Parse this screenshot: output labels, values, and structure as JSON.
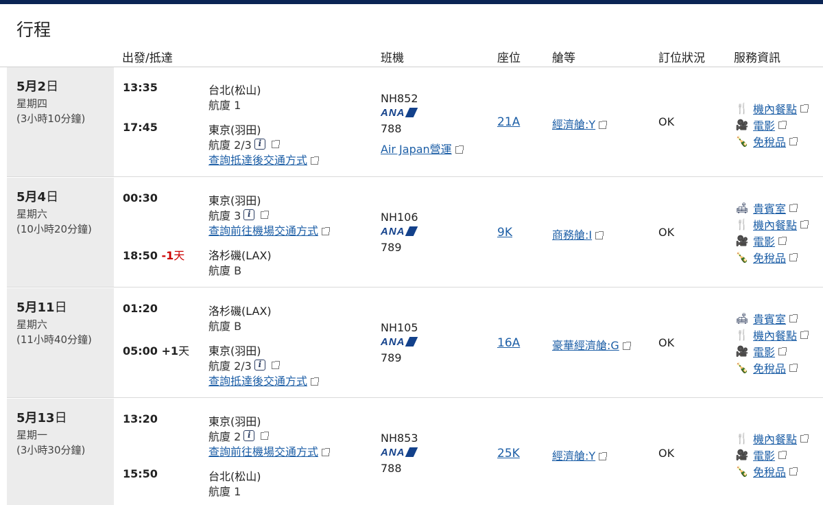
{
  "title": "行程",
  "headers": {
    "dep_arr": "出發/抵達",
    "flight": "班機",
    "seat": "座位",
    "cabin": "艙等",
    "status": "訂位狀況",
    "services": "服務資訊"
  },
  "segments": [
    {
      "date_md": "5月",
      "date_d": "2",
      "date_suffix": "日",
      "dow": "星期四",
      "duration": "(3小時10分鐘)",
      "dep_time": "13:35",
      "dep_city": "台北(松山)",
      "dep_term": "航廈 1",
      "arr_time": "17:45",
      "arr_dayadj": "",
      "arr_city": "東京(羽田)",
      "arr_term": "航廈 2/3",
      "transport": "查詢抵達後交通方式",
      "flight_no": "NH852",
      "airline": "ANA",
      "aircraft": "788",
      "operator": "Air Japan營運",
      "seat": "21A",
      "cabin": "經濟艙:Y",
      "status": "OK",
      "services": [
        "機內餐點",
        "電影",
        "免稅品"
      ]
    },
    {
      "date_md": "5月",
      "date_d": "4",
      "date_suffix": "日",
      "dow": "星期六",
      "duration": "(10小時20分鐘)",
      "dep_time": "00:30",
      "dep_city": "東京(羽田)",
      "dep_term": "航廈 3",
      "dep_transport": "查詢前往機場交通方式",
      "arr_time": "18:50",
      "arr_dayadj_num": "-1",
      "arr_dayadj_unit": "天",
      "arr_city": "洛杉磯(LAX)",
      "arr_term": "航廈 B",
      "flight_no": "NH106",
      "airline": "ANA",
      "aircraft": "789",
      "seat": "9K",
      "cabin": "商務艙:I",
      "status": "OK",
      "services": [
        "貴賓室",
        "機內餐點",
        "電影",
        "免稅品"
      ]
    },
    {
      "date_md": "5月",
      "date_d": "11",
      "date_suffix": "日",
      "dow": "星期六",
      "duration": "(11小時40分鐘)",
      "dep_time": "01:20",
      "dep_city": "洛杉磯(LAX)",
      "dep_term": "航廈 B",
      "arr_time": "05:00",
      "arr_dayadj_num": "+1",
      "arr_dayadj_unit": "天",
      "arr_city": "東京(羽田)",
      "arr_term": "航廈 2/3",
      "transport": "查詢抵達後交通方式",
      "flight_no": "NH105",
      "airline": "ANA",
      "aircraft": "789",
      "seat": "16A",
      "cabin": "豪華經濟艙:G",
      "status": "OK",
      "services": [
        "貴賓室",
        "機內餐點",
        "電影",
        "免稅品"
      ]
    },
    {
      "date_md": "5月",
      "date_d": "13",
      "date_suffix": "日",
      "dow": "星期一",
      "duration": "(3小時30分鐘)",
      "dep_time": "13:20",
      "dep_city": "東京(羽田)",
      "dep_term": "航廈 2",
      "dep_transport": "查詢前往機場交通方式",
      "arr_time": "15:50",
      "arr_city": "台北(松山)",
      "arr_term": "航廈 1",
      "flight_no": "NH853",
      "airline": "ANA",
      "aircraft": "788",
      "seat": "25K",
      "cabin": "經濟艙:Y",
      "status": "OK",
      "services": [
        "機內餐點",
        "電影",
        "免稅品"
      ]
    }
  ]
}
